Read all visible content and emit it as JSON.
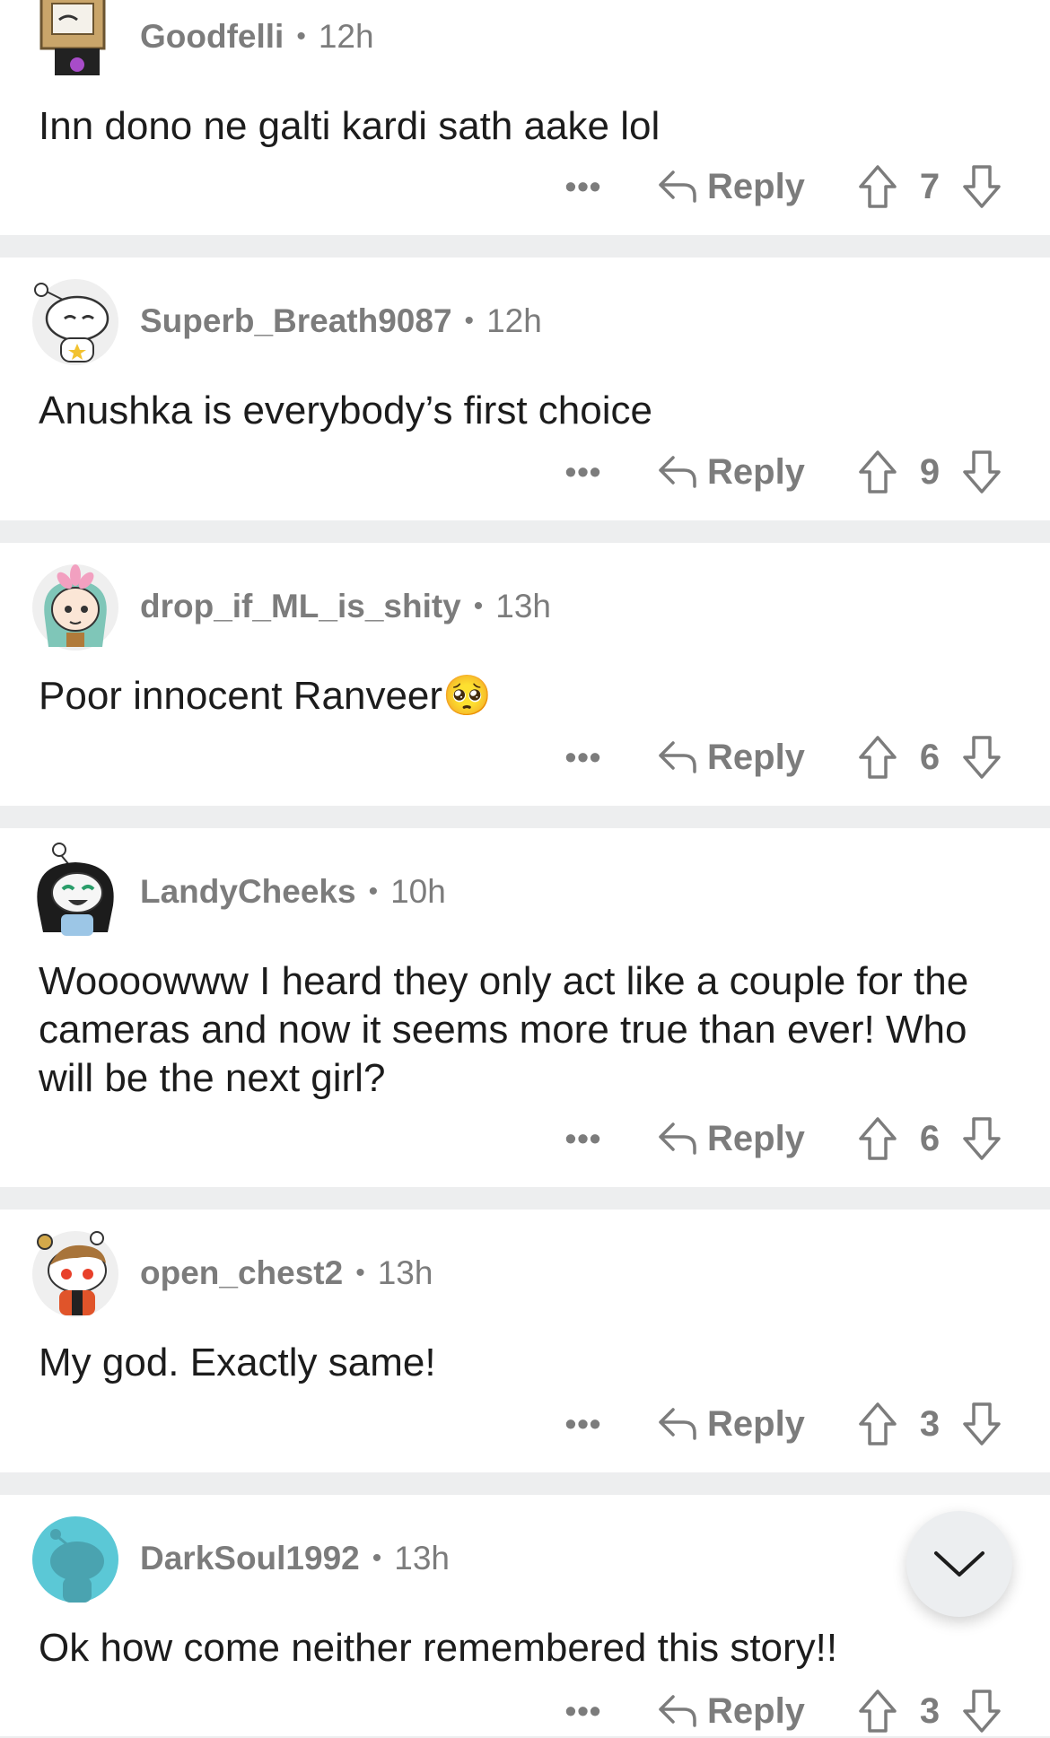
{
  "comments": [
    {
      "username": "Goodfelli",
      "time": "12h",
      "body": "Inn dono ne galti kardi sath aake lol",
      "reply_label": "Reply",
      "score": "7",
      "avatar": "box-head-avatar"
    },
    {
      "username": "Superb_Breath9087",
      "time": "12h",
      "body": "Anushka is everybody’s first choice",
      "reply_label": "Reply",
      "score": "9",
      "avatar": "snoo-white-avatar"
    },
    {
      "username": "drop_if_ML_is_shity",
      "time": "13h",
      "body": "Poor innocent Ranveer",
      "reply_label": "Reply",
      "score": "6",
      "avatar": "flower-hair-avatar"
    },
    {
      "username": "LandyCheeks",
      "time": "10h",
      "body": "Woooowww I heard they only act like a couple for the cameras and now it seems more true than ever! Who will be the next girl?",
      "reply_label": "Reply",
      "score": "6",
      "avatar": "dark-hair-avatar"
    },
    {
      "username": "open_chest2",
      "time": "13h",
      "body": "My god. Exactly same!",
      "reply_label": "Reply",
      "score": "3",
      "avatar": "brown-hair-avatar"
    },
    {
      "username": "DarkSoul1992",
      "time": "13h",
      "body": "Ok how come neither remembered this story!!",
      "reply_label": "Reply",
      "score": "3",
      "avatar": "snoo-teal-avatar"
    }
  ],
  "meta": {
    "separator": "•",
    "more_glyph": "•••"
  },
  "emoji": {
    "pleading": "🥺"
  },
  "colors": {
    "card": "#ffffff",
    "separator": "#edeeef",
    "meta_text": "#7c7c7c",
    "body_text": "#1c1c1c"
  }
}
